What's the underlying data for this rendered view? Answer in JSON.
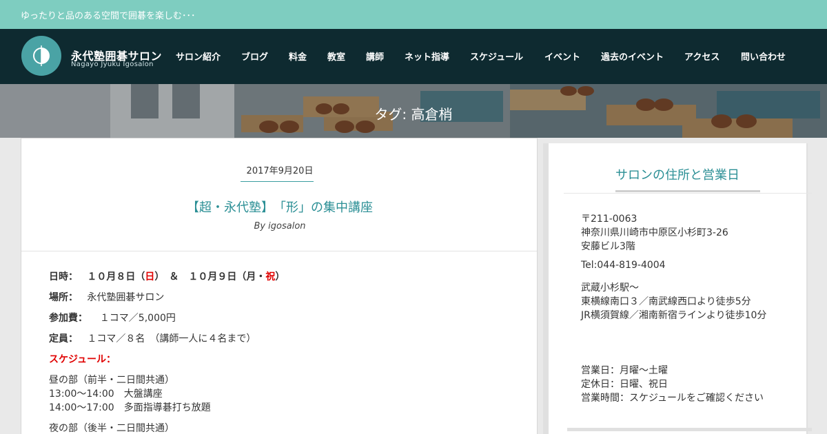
{
  "topbar": {
    "tagline": "ゆったりと品のある空間で囲碁を楽しむ･･･"
  },
  "brand": {
    "name": "永代塾囲碁サロン",
    "sub": "Nagayo Jyuku Igosalon"
  },
  "nav": {
    "items": [
      {
        "label": "サロン紹介"
      },
      {
        "label": "ブログ"
      },
      {
        "label": "料金"
      },
      {
        "label": "教室"
      },
      {
        "label": "講師"
      },
      {
        "label": "ネット指導"
      },
      {
        "label": "スケジュール"
      },
      {
        "label": "イベント"
      },
      {
        "label": "過去のイベント"
      },
      {
        "label": "アクセス"
      },
      {
        "label": "問い合わせ"
      }
    ]
  },
  "hero": {
    "title": "タグ: 高倉梢"
  },
  "post": {
    "date": "2017年9月20日",
    "title": "【超・永代塾】　「形」の集中講座",
    "byline": "By igosalon",
    "date_label": "日時：",
    "date_a": "１０月８日（",
    "date_sun": "日",
    "date_b": "）　＆　１０月９日（月・",
    "date_hol": "祝",
    "date_c": "）",
    "place_label": "場所：",
    "place": "永代塾囲碁サロン",
    "fee_label": "参加費：",
    "fee": "１コマ／5,000円",
    "cap_label": "定員：",
    "cap": "１コマ／８名　（講師一人に４名まで）",
    "schedule_label": "スケジュール：",
    "day_part": "昼の部（前半・二日間共通）",
    "day_row1": "13:00～14:00　大盤講座",
    "day_row2": "14:00～17:00　多面指導碁打ち放題",
    "night_part": "夜の部（後半・二日間共通）"
  },
  "sidebar": {
    "heading": "サロンの住所と営業日",
    "postal": "〒211-0063",
    "address1": "神奈川県川崎市中原区小杉町3-26",
    "address2": "安藤ビル3階",
    "tel": "Tel:044-819-4004",
    "station": "武蔵小杉駅～",
    "route1": "東横線南口３／南武線西口より徒歩5分",
    "route2": "JR横須賀線／湘南新宿ラインより徒歩10分",
    "open_days": "営業日：月曜～土曜",
    "closed_days": "定休日：日曜、祝日",
    "hours": "営業時間：スケジュールをご確認ください"
  },
  "colors": {
    "accent": "#2b8f95",
    "topbar": "#7ecdc0",
    "header": "#0e2a30",
    "highlight": "#e00000"
  }
}
